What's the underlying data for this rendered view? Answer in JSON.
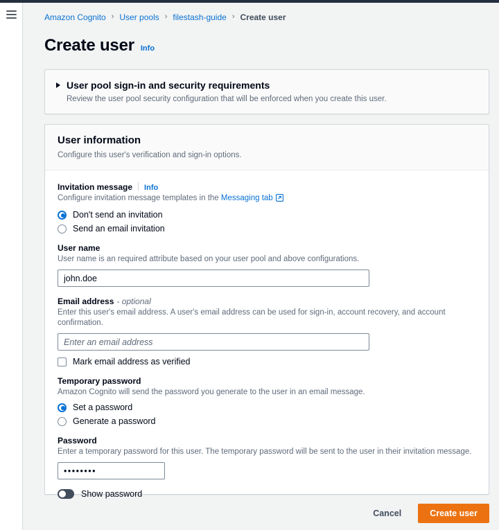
{
  "window": {
    "accent_orange": "#ec7211",
    "link_blue": "#0972d3",
    "page_background": "#f2f3f3"
  },
  "nav": {
    "menu_icon": "hamburger-menu-icon"
  },
  "breadcrumb": {
    "items": [
      {
        "label": "Amazon Cognito",
        "current": false
      },
      {
        "label": "User pools",
        "current": false
      },
      {
        "label": "filestash-guide",
        "current": false
      },
      {
        "label": "Create user",
        "current": true
      }
    ],
    "separator": "›"
  },
  "page": {
    "title": "Create user",
    "info_label": "Info"
  },
  "signin_section": {
    "title": "User pool sign-in and security requirements",
    "description": "Review the user pool security configuration that will be enforced when you create this user.",
    "expanded": false,
    "caret_icon": "caret-right-icon"
  },
  "user_information": {
    "title": "User information",
    "description": "Configure this user's verification and sign-in options.",
    "invitation": {
      "label": "Invitation message",
      "info_label": "Info",
      "description_prefix": "Configure invitation message templates in the ",
      "link_label": "Messaging tab",
      "link_icon": "external-link-icon",
      "options": [
        {
          "label": "Don't send an invitation",
          "selected": true
        },
        {
          "label": "Send an email invitation",
          "selected": false
        }
      ]
    },
    "user_name": {
      "label": "User name",
      "description": "User name is an required attribute based on your user pool and above configurations.",
      "value": "john.doe",
      "placeholder": ""
    },
    "email": {
      "label": "Email address",
      "optional_label": "- optional",
      "description": "Enter this user's email address. A user's email address can be used for sign-in, account recovery, and account confirmation.",
      "value": "",
      "placeholder": "Enter an email address",
      "verified_checkbox": {
        "label": "Mark email address as verified",
        "checked": false
      }
    },
    "temporary_password": {
      "label": "Temporary password",
      "description": "Amazon Cognito will send the password you generate to the user in an email message.",
      "options": [
        {
          "label": "Set a password",
          "selected": true
        },
        {
          "label": "Generate a password",
          "selected": false
        }
      ]
    },
    "password": {
      "label": "Password",
      "description": "Enter a temporary password for this user. The temporary password will be sent to the user in their invitation message.",
      "value": "••••••••",
      "placeholder": "",
      "show_password_toggle": {
        "label": "Show password",
        "on": false
      }
    }
  },
  "footer": {
    "cancel_label": "Cancel",
    "submit_label": "Create user"
  }
}
